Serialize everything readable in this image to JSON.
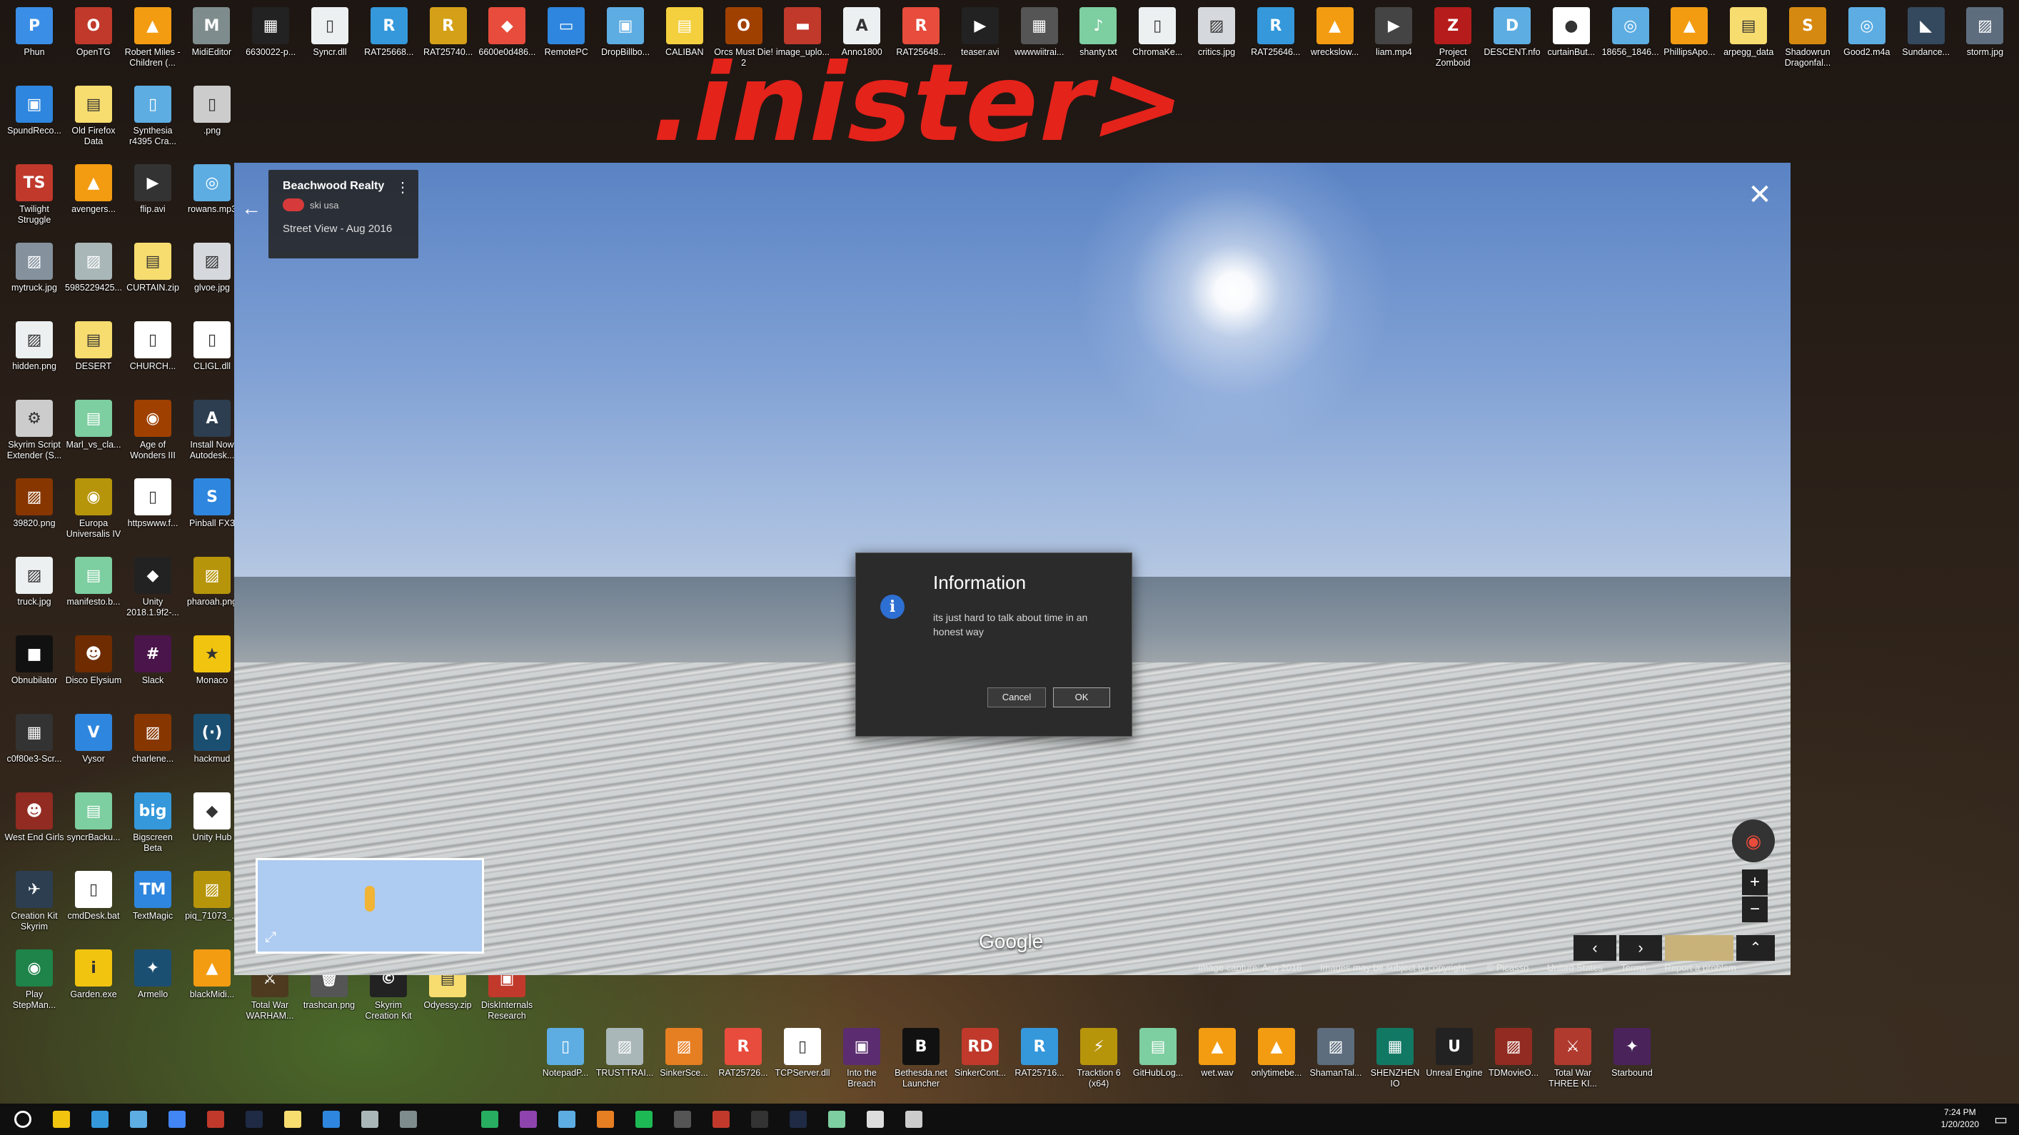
{
  "wallpaper": {
    "text": ".inister>"
  },
  "desktop_icons": [
    {
      "label": "Phun",
      "color": "#3a8ee6",
      "glyph": "P"
    },
    {
      "label": "OpenTG",
      "color": "#c0392b",
      "glyph": "O"
    },
    {
      "label": "Robert Miles - Children (...",
      "color": "#f39c12",
      "glyph": "▲"
    },
    {
      "label": "MidiEditor",
      "color": "#7f8c8d",
      "glyph": "M"
    },
    {
      "label": "6630022-p...",
      "color": "#222222",
      "glyph": "▦"
    },
    {
      "label": "Syncr.dll",
      "color": "#ecf0f1",
      "glyph": "▯"
    },
    {
      "label": "RAT25668...",
      "color": "#3498db",
      "glyph": "R"
    },
    {
      "label": "RAT25740...",
      "color": "#d4a017",
      "glyph": "R"
    },
    {
      "label": "6600e0d486...",
      "color": "#e74c3c",
      "glyph": "◆"
    },
    {
      "label": "RemotePC",
      "color": "#2e86de",
      "glyph": "▭"
    },
    {
      "label": "DropBillbo...",
      "color": "#5dade2",
      "glyph": "▣"
    },
    {
      "label": "CALIBAN",
      "color": "#f4d03f",
      "glyph": "▤"
    },
    {
      "label": "Orcs Must Die! 2",
      "color": "#a04000",
      "glyph": "O"
    },
    {
      "label": "image_uplo...",
      "color": "#c0392b",
      "glyph": "▬"
    },
    {
      "label": "Anno1800",
      "color": "#ecf0f1",
      "glyph": "A"
    },
    {
      "label": "RAT25648...",
      "color": "#e74c3c",
      "glyph": "R"
    },
    {
      "label": "teaser.avi",
      "color": "#222222",
      "glyph": "▶"
    },
    {
      "label": "wwwwiitrai...",
      "color": "#555555",
      "glyph": "▦"
    },
    {
      "label": "shanty.txt",
      "color": "#7dcea0",
      "glyph": "♪"
    },
    {
      "label": "ChromaKe...",
      "color": "#ecf0f1",
      "glyph": "▯"
    },
    {
      "label": "critics.jpg",
      "color": "#d5d8dc",
      "glyph": "▨"
    },
    {
      "label": "RAT25646...",
      "color": "#3498db",
      "glyph": "R"
    },
    {
      "label": "wreckslow...",
      "color": "#f39c12",
      "glyph": "▲"
    },
    {
      "label": "liam.mp4",
      "color": "#444444",
      "glyph": "▶"
    },
    {
      "label": "Project Zomboid",
      "color": "#b71c1c",
      "glyph": "Z"
    },
    {
      "label": "DESCENT.nfo",
      "color": "#5dade2",
      "glyph": "D"
    },
    {
      "label": "curtainBut...",
      "color": "#ffffff",
      "glyph": "●"
    },
    {
      "label": "18656_1846...",
      "color": "#5dade2",
      "glyph": "◎"
    },
    {
      "label": "PhillipsApo...",
      "color": "#f39c12",
      "glyph": "▲"
    },
    {
      "label": "arpegg_data",
      "color": "#f7dc6f",
      "glyph": "▤"
    },
    {
      "label": "Shadowrun Dragonfal...",
      "color": "#d68910",
      "glyph": "S"
    },
    {
      "label": "Good2.m4a",
      "color": "#5dade2",
      "glyph": "◎"
    },
    {
      "label": "Sundance...",
      "color": "#34495e",
      "glyph": "◣"
    },
    {
      "label": "storm.jpg",
      "color": "#5d6d7e",
      "glyph": "▨"
    },
    {
      "label": "SpundReco...",
      "color": "#2e86de",
      "glyph": "▣"
    },
    {
      "label": "Old Firefox Data",
      "color": "#f7dc6f",
      "glyph": "▤"
    },
    {
      "label": "Synthesia r4395 Cra...",
      "color": "#5dade2",
      "glyph": "▯"
    },
    {
      "label": ".png",
      "color": "#cccccc",
      "glyph": "▯"
    },
    {
      "label": "Twilight Struggle",
      "color": "#c0392b",
      "glyph": "TS"
    },
    {
      "label": "avengers...",
      "color": "#f39c12",
      "glyph": "▲"
    },
    {
      "label": "flip.avi",
      "color": "#333333",
      "glyph": "▶"
    },
    {
      "label": "rowans.mp3",
      "color": "#5dade2",
      "glyph": "◎"
    },
    {
      "label": "mytruck.jpg",
      "color": "#85929e",
      "glyph": "▨"
    },
    {
      "label": "5985229425...",
      "color": "#aab7b8",
      "glyph": "▨"
    },
    {
      "label": "CURTAIN.zip",
      "color": "#f7dc6f",
      "glyph": "▤"
    },
    {
      "label": "glvoe.jpg",
      "color": "#d5d8dc",
      "glyph": "▨"
    },
    {
      "label": "hidden.png",
      "color": "#ecf0f1",
      "glyph": "▨"
    },
    {
      "label": "DESERT",
      "color": "#f7dc6f",
      "glyph": "▤"
    },
    {
      "label": "CHURCH...",
      "color": "#ffffff",
      "glyph": "▯"
    },
    {
      "label": "CLIGL.dll",
      "color": "#ffffff",
      "glyph": "▯"
    },
    {
      "label": "Skyrim Script Extender (S...",
      "color": "#cccccc",
      "glyph": "⚙"
    },
    {
      "label": "Marl_vs_cla...",
      "color": "#7dcea0",
      "glyph": "▤"
    },
    {
      "label": "Age of Wonders III",
      "color": "#a04000",
      "glyph": "◉"
    },
    {
      "label": "Install Now Autodesk...",
      "color": "#2c3e50",
      "glyph": "A"
    },
    {
      "label": "39820.png",
      "color": "#873600",
      "glyph": "▨"
    },
    {
      "label": "Europa Universalis IV",
      "color": "#b7950b",
      "glyph": "◉"
    },
    {
      "label": "httpswww.f...",
      "color": "#ffffff",
      "glyph": "▯"
    },
    {
      "label": "Pinball FX3",
      "color": "#2e86de",
      "glyph": "S"
    },
    {
      "label": "truck.jpg",
      "color": "#ecf0f1",
      "glyph": "▨"
    },
    {
      "label": "manifesto.b...",
      "color": "#7dcea0",
      "glyph": "▤"
    },
    {
      "label": "Unity 2018.1.9f2-...",
      "color": "#222222",
      "glyph": "◆"
    },
    {
      "label": "pharoah.png",
      "color": "#b7950b",
      "glyph": "▨"
    },
    {
      "label": "Obnubilator",
      "color": "#111111",
      "glyph": "■"
    },
    {
      "label": "Disco Elysium",
      "color": "#6e2c00",
      "glyph": "☻"
    },
    {
      "label": "Slack",
      "color": "#4a154b",
      "glyph": "#"
    },
    {
      "label": "Monaco",
      "color": "#f1c40f",
      "glyph": "★"
    },
    {
      "label": "c0f80e3-Scr...",
      "color": "#333333",
      "glyph": "▦"
    },
    {
      "label": "Vysor",
      "color": "#2e86de",
      "glyph": "V"
    },
    {
      "label": "charlene...",
      "color": "#873600",
      "glyph": "▨"
    },
    {
      "label": "hackmud",
      "color": "#1b4f72",
      "glyph": "(·)"
    },
    {
      "label": "West End Girls",
      "color": "#922b21",
      "glyph": "☻"
    },
    {
      "label": "syncrBacku...",
      "color": "#7dcea0",
      "glyph": "▤"
    },
    {
      "label": "Bigscreen Beta",
      "color": "#3498db",
      "glyph": "big"
    },
    {
      "label": "Unity Hub",
      "color": "#ffffff",
      "glyph": "◆"
    },
    {
      "label": "Creation Kit Skyrim",
      "color": "#2c3e50",
      "glyph": "✈"
    },
    {
      "label": "cmdDesk.bat",
      "color": "#ffffff",
      "glyph": "▯"
    },
    {
      "label": "TextMagic",
      "color": "#2e86de",
      "glyph": "TM"
    },
    {
      "label": "piq_71073_...",
      "color": "#b7950b",
      "glyph": "▨"
    },
    {
      "label": "Play StepMan...",
      "color": "#1e8449",
      "glyph": "◉"
    },
    {
      "label": "Garden.exe",
      "color": "#f1c40f",
      "glyph": "i"
    },
    {
      "label": "Armello",
      "color": "#1b4f72",
      "glyph": "✦"
    },
    {
      "label": "blackMidi...",
      "color": "#f39c12",
      "glyph": "▲"
    },
    {
      "label": "Total War WARHAM...",
      "color": "#4d3a1f",
      "glyph": "⚔"
    },
    {
      "label": "trashcan.png",
      "color": "#555555",
      "glyph": "🗑"
    },
    {
      "label": "Skyrim Creation Kit",
      "color": "#222222",
      "glyph": "©"
    },
    {
      "label": "Odyessy.zip",
      "color": "#f7dc6f",
      "glyph": "▤"
    },
    {
      "label": "DiskInternals Research",
      "color": "#c0392b",
      "glyph": "▣"
    },
    {
      "label": "NotepadP...",
      "color": "#5dade2",
      "glyph": "▯"
    },
    {
      "label": "TRUSTTRAI...",
      "color": "#aab7b8",
      "glyph": "▨"
    },
    {
      "label": "SinkerSce...",
      "color": "#e67e22",
      "glyph": "▨"
    },
    {
      "label": "RAT25726...",
      "color": "#e74c3c",
      "glyph": "R"
    },
    {
      "label": "TCPServer.dll",
      "color": "#ffffff",
      "glyph": "▯"
    },
    {
      "label": "Into the Breach",
      "color": "#5b2c6f",
      "glyph": "▣"
    },
    {
      "label": "Bethesda.net Launcher",
      "color": "#111111",
      "glyph": "B"
    },
    {
      "label": "SinkerCont...",
      "color": "#c0392b",
      "glyph": "RD"
    },
    {
      "label": "RAT25716...",
      "color": "#3498db",
      "glyph": "R"
    },
    {
      "label": "Tracktion 6 (x64)",
      "color": "#b7950b",
      "glyph": "⚡"
    },
    {
      "label": "GitHubLog...",
      "color": "#7dcea0",
      "glyph": "▤"
    },
    {
      "label": "wet.wav",
      "color": "#f39c12",
      "glyph": "▲"
    },
    {
      "label": "onlytimebe...",
      "color": "#f39c12",
      "glyph": "▲"
    },
    {
      "label": "ShamanTal...",
      "color": "#5d6d7e",
      "glyph": "▨"
    },
    {
      "label": "SHENZHEN IO",
      "color": "#117864",
      "glyph": "▦"
    },
    {
      "label": "Unreal Engine",
      "color": "#222222",
      "glyph": "U"
    },
    {
      "label": "TDMovieO...",
      "color": "#922b21",
      "glyph": "▨"
    },
    {
      "label": "Total War THREE KI...",
      "color": "#b03a2e",
      "glyph": "⚔"
    },
    {
      "label": "Starbound",
      "color": "#4a235a",
      "glyph": "✦"
    }
  ],
  "street_view": {
    "place_name": "Beachwood Realty",
    "place_sub": "ski usa",
    "date": "Street View - Aug 2016",
    "google": "Google",
    "footer": [
      "Image capture: Aug 2016",
      "Images may be subject to copyright.",
      "© Picasso",
      "United States",
      "Terms",
      "Report a problem"
    ]
  },
  "dialog": {
    "title": "Information",
    "message": "its just hard to talk about time in an honest way",
    "cancel": "Cancel",
    "ok": "OK"
  },
  "taskbar": {
    "time": "7:24 PM",
    "date": "1/20/2020",
    "icons": [
      "cortana",
      "file-explorer",
      "store",
      "mail",
      "chrome",
      "game",
      "steam",
      "folder",
      "photos",
      "app",
      "app",
      "minecraft",
      "visual-studio",
      "browser",
      "firefox",
      "spotify",
      "obs",
      "app",
      "terminal",
      "steam",
      "notepad",
      "unity",
      "github"
    ]
  }
}
